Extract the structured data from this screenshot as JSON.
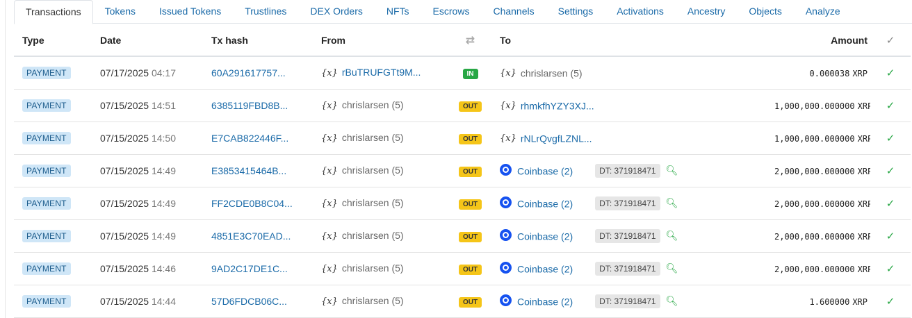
{
  "tabs": [
    {
      "label": "Transactions",
      "active": true
    },
    {
      "label": "Tokens",
      "active": false
    },
    {
      "label": "Issued Tokens",
      "active": false
    },
    {
      "label": "Trustlines",
      "active": false
    },
    {
      "label": "DEX Orders",
      "active": false
    },
    {
      "label": "NFTs",
      "active": false
    },
    {
      "label": "Escrows",
      "active": false
    },
    {
      "label": "Channels",
      "active": false
    },
    {
      "label": "Settings",
      "active": false
    },
    {
      "label": "Activations",
      "active": false
    },
    {
      "label": "Ancestry",
      "active": false
    },
    {
      "label": "Objects",
      "active": false
    },
    {
      "label": "Analyze",
      "active": false
    }
  ],
  "table": {
    "headers": {
      "type": "Type",
      "date": "Date",
      "hash": "Tx hash",
      "from": "From",
      "direction_icon": "swap-arrows-icon",
      "to": "To",
      "amount": "Amount",
      "status_icon": "check-icon"
    },
    "rows": [
      {
        "type": "PAYMENT",
        "date": "07/17/2025",
        "time": "04:17",
        "hash": "60A291617757...",
        "from": "rBuTRUFGTt9M...",
        "from_link": true,
        "direction": "IN",
        "to": "chrislarsen (5)",
        "to_link": false,
        "to_icon": "xrp-account-icon",
        "dt": "",
        "amount": "0.000038",
        "currency": "XRP"
      },
      {
        "type": "PAYMENT",
        "date": "07/15/2025",
        "time": "14:51",
        "hash": "6385119FBD8B...",
        "from": "chrislarsen (5)",
        "from_link": false,
        "direction": "OUT",
        "to": "rhmkfhYZY3XJ...",
        "to_link": true,
        "to_icon": "xrp-account-icon",
        "dt": "",
        "amount": "1,000,000.000000",
        "currency": "XRP"
      },
      {
        "type": "PAYMENT",
        "date": "07/15/2025",
        "time": "14:50",
        "hash": "E7CAB822446F...",
        "from": "chrislarsen (5)",
        "from_link": false,
        "direction": "OUT",
        "to": "rNLrQvgfLZNL...",
        "to_link": true,
        "to_icon": "xrp-account-icon",
        "dt": "",
        "amount": "1,000,000.000000",
        "currency": "XRP"
      },
      {
        "type": "PAYMENT",
        "date": "07/15/2025",
        "time": "14:49",
        "hash": "E3853415464B...",
        "from": "chrislarsen (5)",
        "from_link": false,
        "direction": "OUT",
        "to": "Coinbase (2)",
        "to_link": true,
        "to_icon": "coinbase-icon",
        "dt": "DT: 371918471",
        "amount": "2,000,000.000000",
        "currency": "XRP"
      },
      {
        "type": "PAYMENT",
        "date": "07/15/2025",
        "time": "14:49",
        "hash": "FF2CDE0B8C04...",
        "from": "chrislarsen (5)",
        "from_link": false,
        "direction": "OUT",
        "to": "Coinbase (2)",
        "to_link": true,
        "to_icon": "coinbase-icon",
        "dt": "DT: 371918471",
        "amount": "2,000,000.000000",
        "currency": "XRP"
      },
      {
        "type": "PAYMENT",
        "date": "07/15/2025",
        "time": "14:49",
        "hash": "4851E3C70EAD...",
        "from": "chrislarsen (5)",
        "from_link": false,
        "direction": "OUT",
        "to": "Coinbase (2)",
        "to_link": true,
        "to_icon": "coinbase-icon",
        "dt": "DT: 371918471",
        "amount": "2,000,000.000000",
        "currency": "XRP"
      },
      {
        "type": "PAYMENT",
        "date": "07/15/2025",
        "time": "14:46",
        "hash": "9AD2C17DE1C...",
        "from": "chrislarsen (5)",
        "from_link": false,
        "direction": "OUT",
        "to": "Coinbase (2)",
        "to_link": true,
        "to_icon": "coinbase-icon",
        "dt": "DT: 371918471",
        "amount": "2,000,000.000000",
        "currency": "XRP"
      },
      {
        "type": "PAYMENT",
        "date": "07/15/2025",
        "time": "14:44",
        "hash": "57D6FDCB06C...",
        "from": "chrislarsen (5)",
        "from_link": false,
        "direction": "OUT",
        "to": "Coinbase (2)",
        "to_link": true,
        "to_icon": "coinbase-icon",
        "dt": "DT: 371918471",
        "amount": "1.600000",
        "currency": "XRP"
      }
    ]
  },
  "colors": {
    "link": "#1a6aa8",
    "type_badge_bg": "#cfe6f7",
    "in_badge": "#28a745",
    "out_badge": "#f5c518",
    "check": "#28a745",
    "coinbase": "#1652f0"
  }
}
